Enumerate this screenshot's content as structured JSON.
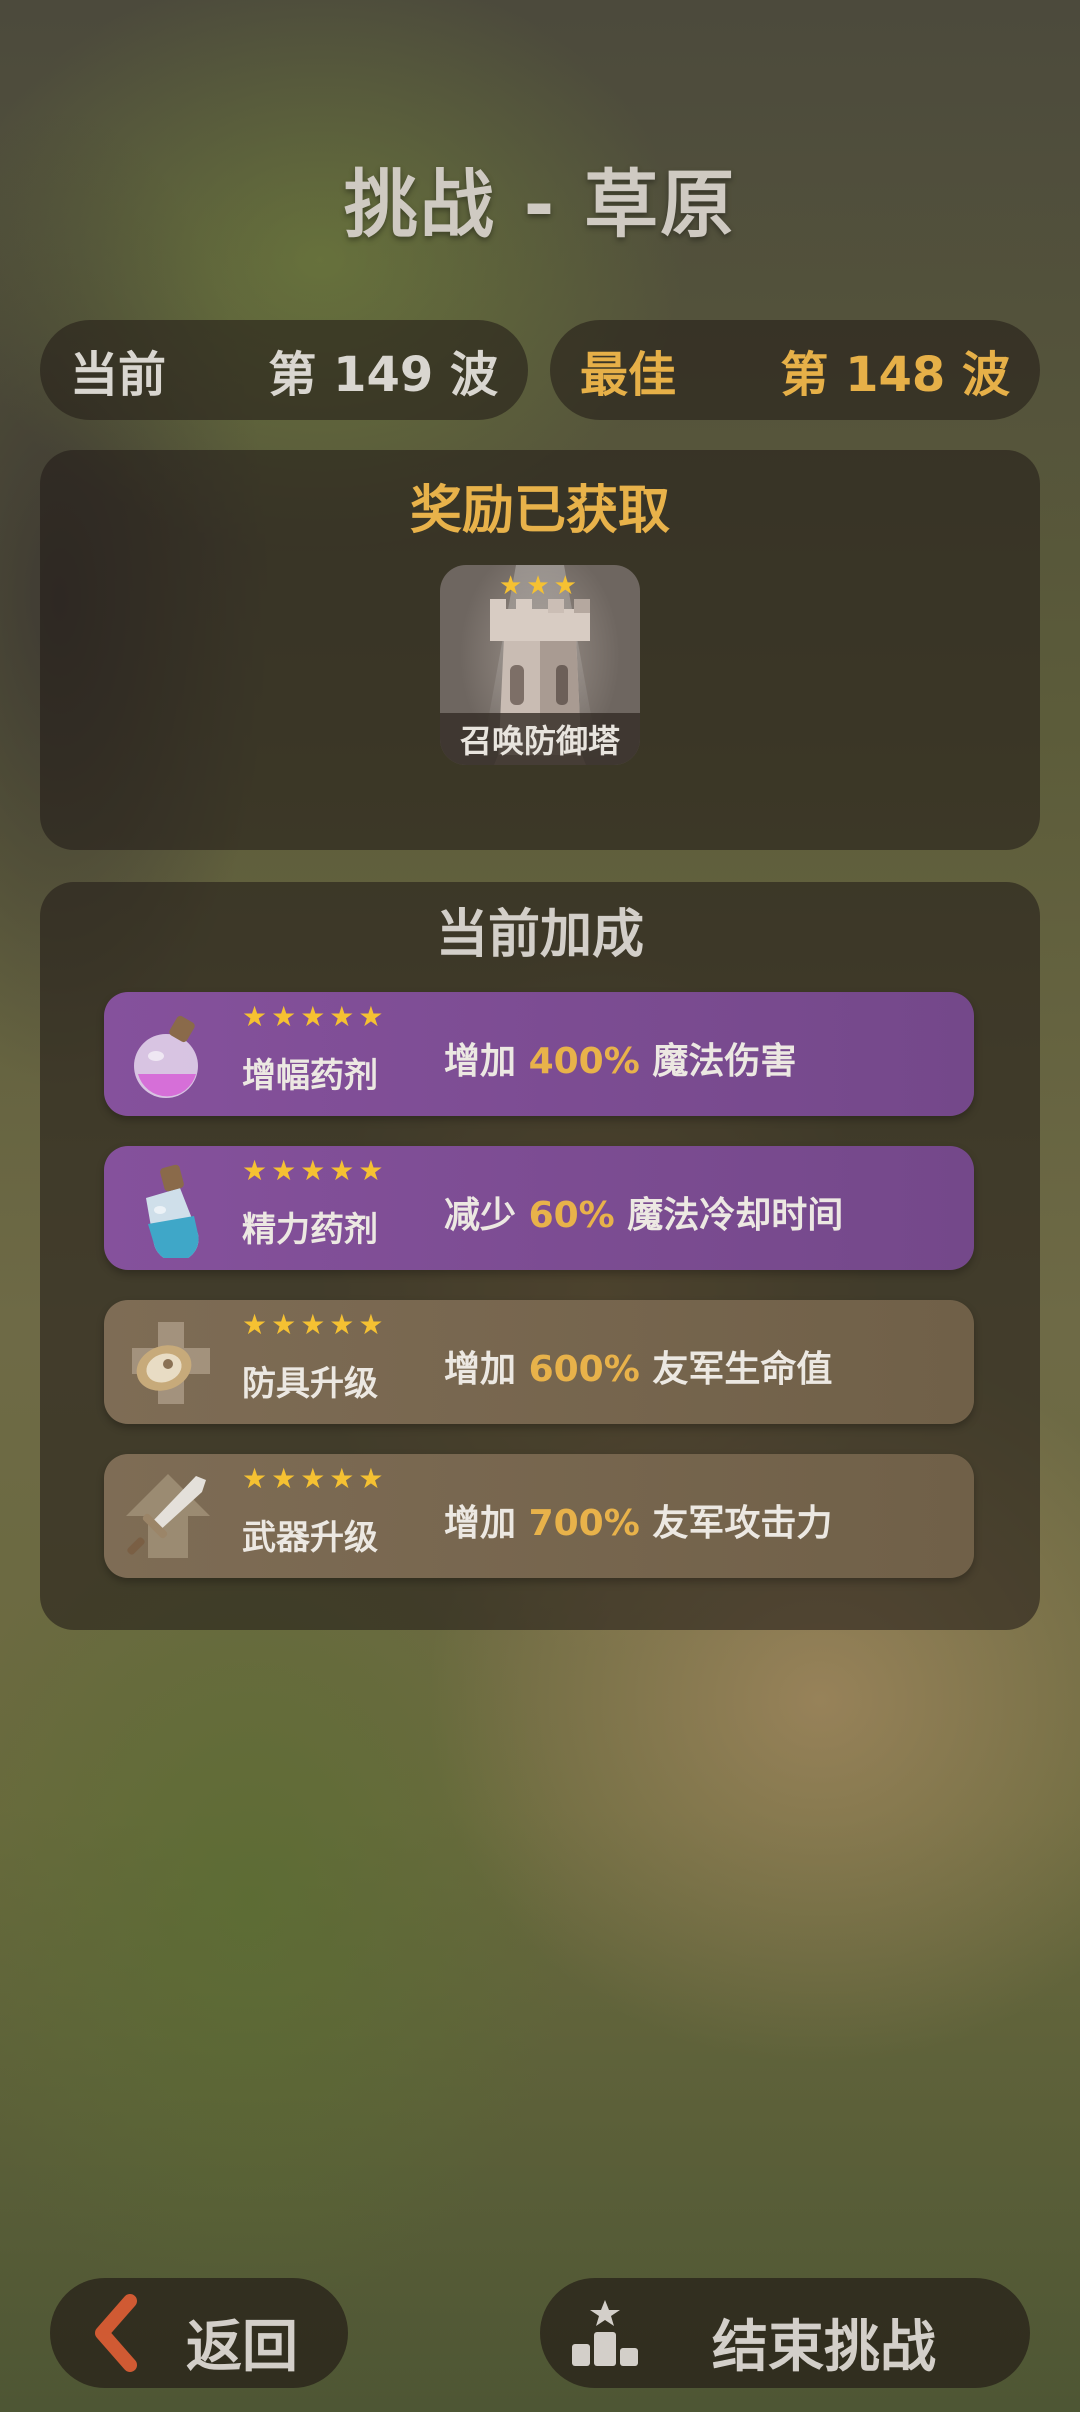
{
  "title": "挑战 - 草原",
  "current": {
    "label": "当前",
    "value": "第 149 波"
  },
  "best": {
    "label": "最佳",
    "value": "第 148 波"
  },
  "reward": {
    "title": "奖励已获取",
    "card": {
      "name": "召唤防御塔",
      "stars": "★★★",
      "icon": "tower-icon"
    }
  },
  "bonus": {
    "title": "当前加成",
    "items": [
      {
        "name": "增幅药剂",
        "stars": "★★★★★",
        "prefix": "增加",
        "value": "400%",
        "suffix": "魔法伤害",
        "icon": "purple-potion-icon",
        "color": "purple"
      },
      {
        "name": "精力药剂",
        "stars": "★★★★★",
        "prefix": "减少",
        "value": "60%",
        "suffix": "魔法冷却时间",
        "icon": "blue-potion-icon",
        "color": "purple"
      },
      {
        "name": "防具升级",
        "stars": "★★★★★",
        "prefix": "增加",
        "value": "600%",
        "suffix": "友军生命值",
        "icon": "shield-upgrade-icon",
        "color": "brown"
      },
      {
        "name": "武器升级",
        "stars": "★★★★★",
        "prefix": "增加",
        "value": "700%",
        "suffix": "友军攻击力",
        "icon": "sword-upgrade-icon",
        "color": "brown"
      }
    ]
  },
  "buttons": {
    "back": {
      "label": "返回",
      "icon": "back-chevron-icon"
    },
    "end": {
      "label": "结束挑战",
      "icon": "leaderboard-icon"
    }
  },
  "colors": {
    "gold": "#e8b24a",
    "purple_row": "#7d4d95",
    "brown_row": "#776650",
    "star": "#f5c132"
  }
}
